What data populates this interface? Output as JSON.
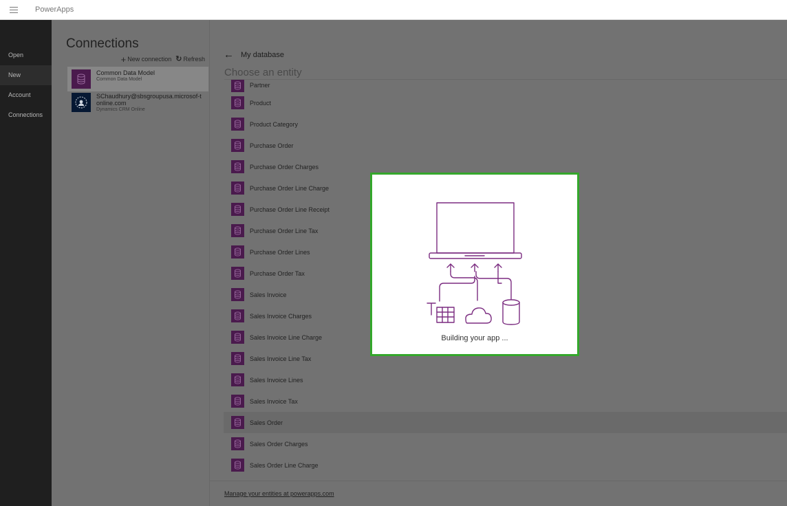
{
  "app": {
    "title": "PowerApps"
  },
  "nav": {
    "items": [
      "Open",
      "New",
      "Account",
      "Connections"
    ]
  },
  "connections": {
    "title": "Connections",
    "new_label": "New connection",
    "refresh_label": "Refresh",
    "items": [
      {
        "name": "Common Data Model",
        "sub": "Common Data Model"
      },
      {
        "name": "SChaudhury@sbsgroupusa.microsof-tonline.com",
        "sub": "Dynamics CRM Online"
      }
    ]
  },
  "main": {
    "back_label": "My database",
    "heading": "Choose an entity",
    "entities": [
      "Partner",
      "Product",
      "Product Category",
      "Purchase Order",
      "Purchase Order Charges",
      "Purchase Order Line Charge",
      "Purchase Order Line Receipt",
      "Purchase Order Line Tax",
      "Purchase Order Lines",
      "Purchase Order Tax",
      "Sales Invoice",
      "Sales Invoice Charges",
      "Sales Invoice Line Charge",
      "Sales Invoice Line Tax",
      "Sales Invoice Lines",
      "Sales Invoice Tax",
      "Sales Order",
      "Sales Order Charges",
      "Sales Order Line Charge"
    ],
    "selected_entity": "Sales Order",
    "footer_link": "Manage your entities at powerapps.com"
  },
  "modal": {
    "status": "Building your app ...",
    "accent_color": "#34a72b",
    "illustration_color": "#7b2c80"
  }
}
